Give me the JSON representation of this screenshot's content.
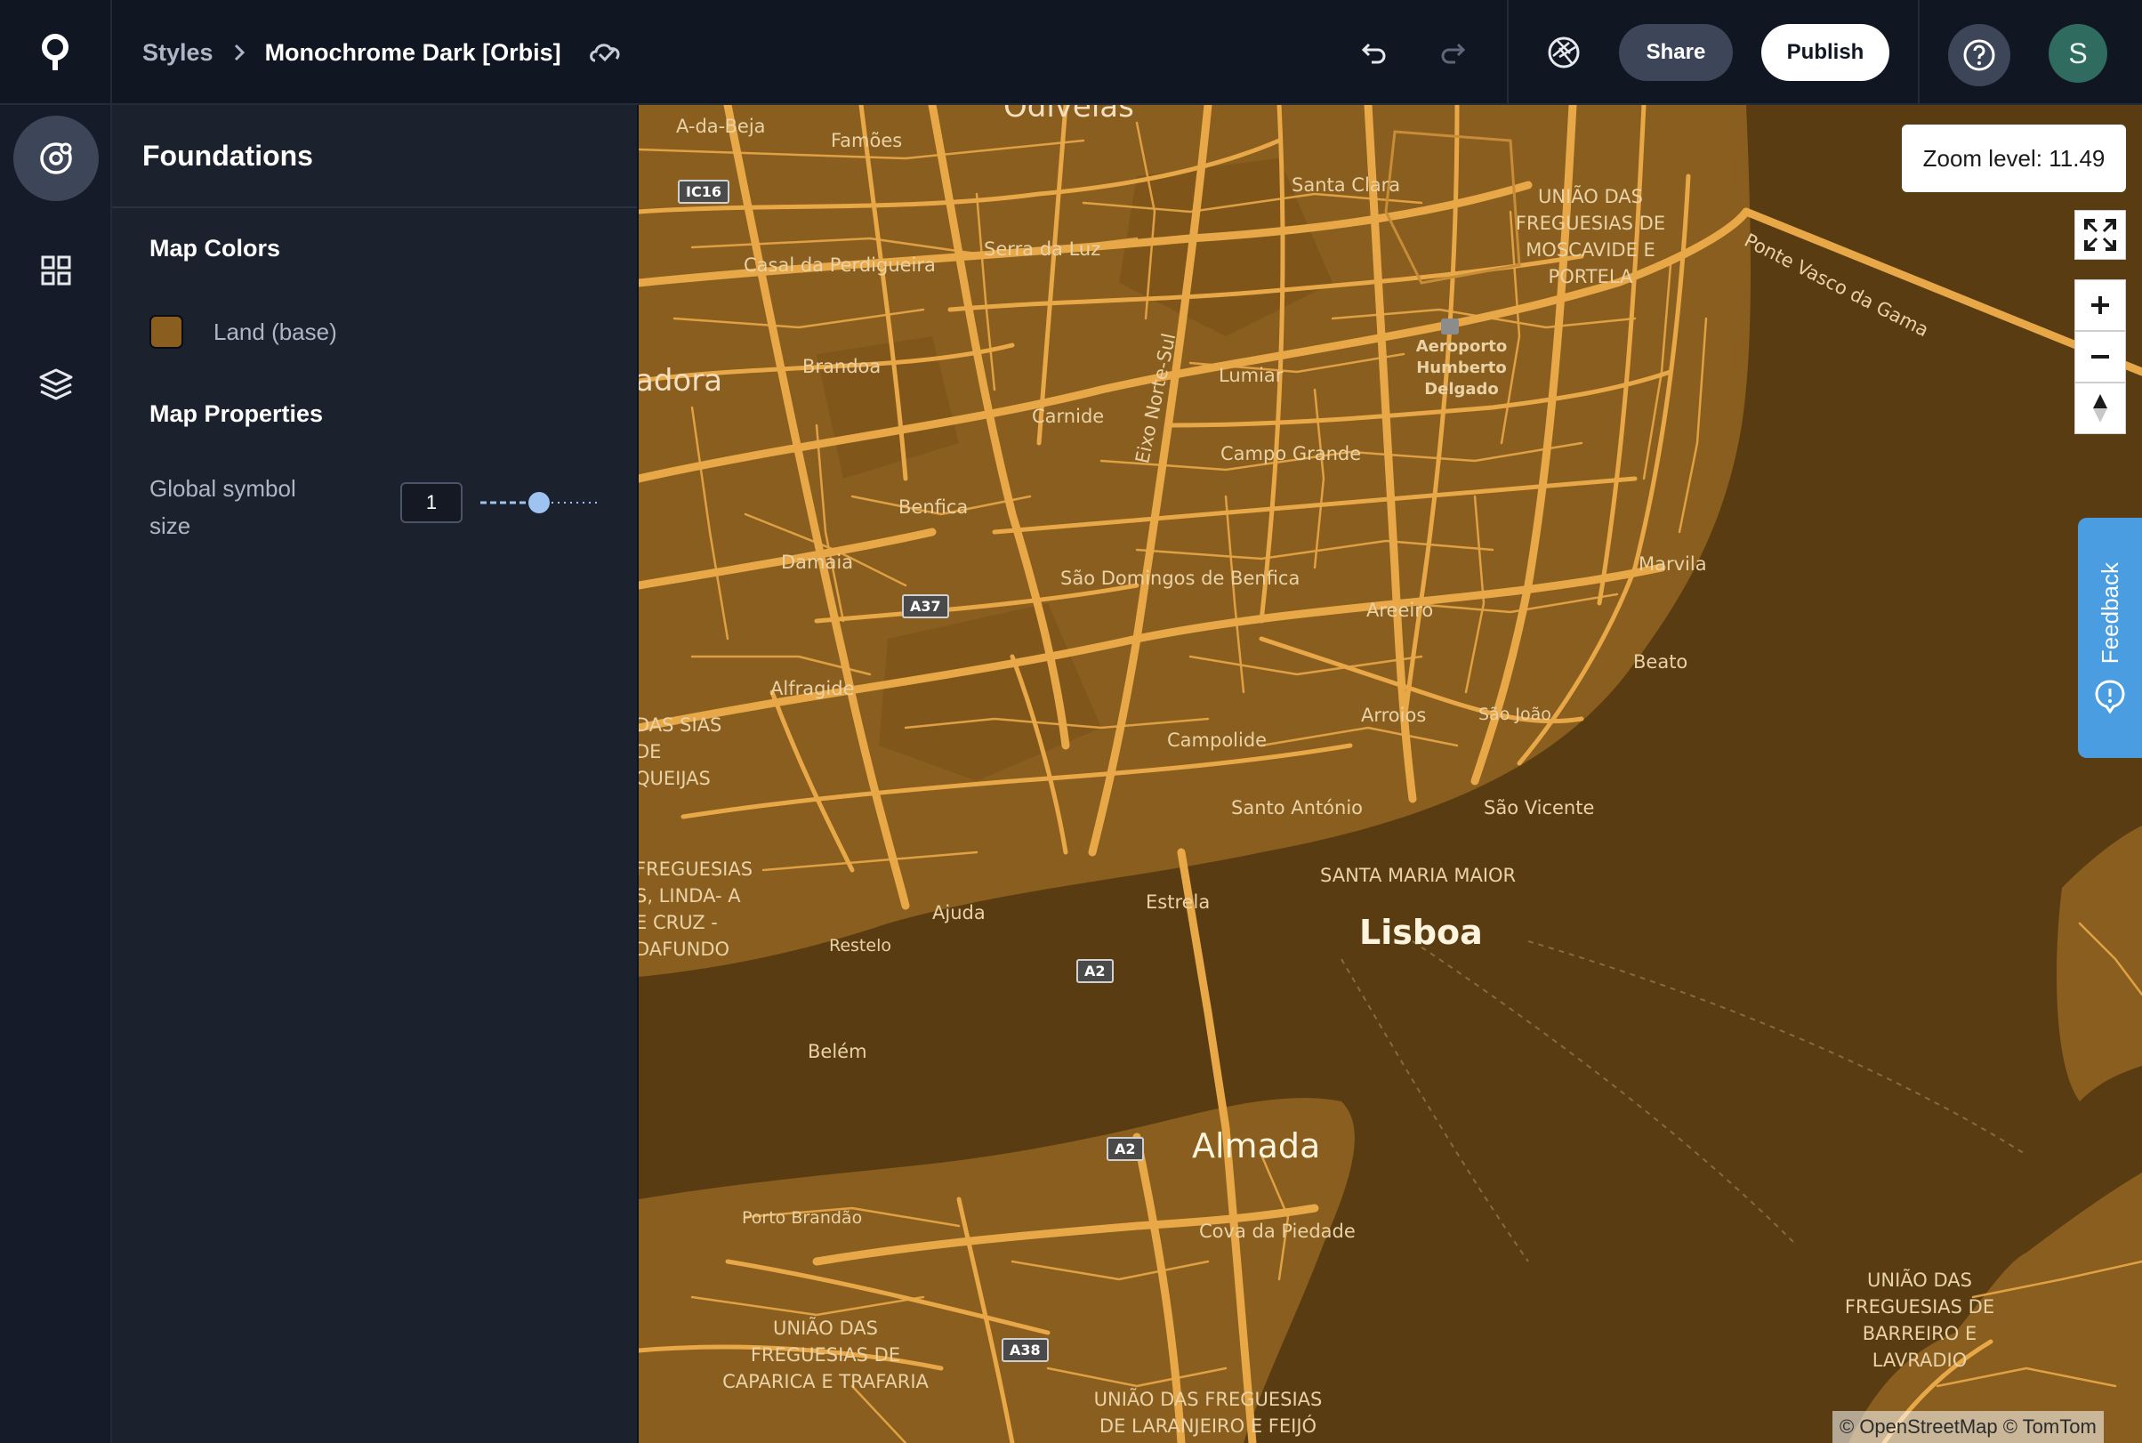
{
  "header": {
    "breadcrumb_root": "Styles",
    "style_name": "Monochrome Dark [Orbis]",
    "share_label": "Share",
    "publish_label": "Publish",
    "avatar_initial": "S"
  },
  "panel": {
    "title": "Foundations",
    "map_colors_title": "Map Colors",
    "land_label": "Land (base)",
    "land_color": "#8a5e1e",
    "map_properties_title": "Map Properties",
    "global_symbol_size_label": "Global symbol size",
    "global_symbol_size_value": "1"
  },
  "map": {
    "zoom_label": "Zoom level: 11.49",
    "feedback_label": "Feedback",
    "attribution": "© OpenStreetMap © TomTom",
    "water_color": "#5a3c12",
    "land_color": "#8a5e1e",
    "road_color": "#e8a848",
    "labels": {
      "odivelas": "Odivelas",
      "a_da_beja": "A-da-Beja",
      "famoes": "Famões",
      "santa_clara": "Santa Clara",
      "uniao_moscavide": "UNIÃO DAS FREGUESIAS DE MOSCAVIDE E PORTELA",
      "ponte": "Ponte Vasco da Gama",
      "casal": "Casal da Perdigueira",
      "serra": "Serra da Luz",
      "amadora": "adora",
      "brandoa": "Brandoa",
      "eixo": "Eixo Norte-Sul",
      "lumiar": "Lumiar",
      "aeroporto": "Aeroporto Humberto Delgado",
      "carnide": "Carnide",
      "campo_grande": "Campo Grande",
      "benfica": "Benfica",
      "damaia": "Damaia",
      "sao_domingos": "São Domingos de Benfica",
      "marvila": "Marvila",
      "areeiro": "Areeiro",
      "beato": "Beato",
      "alfragide": "Alfragide",
      "das_queijas": "DAS SIAS DE QUEIJAS",
      "arroios": "Arroios",
      "sao_joao": "São João",
      "campolide": "Campolide",
      "santo_antonio": "Santo António",
      "sao_vicente": "São Vicente",
      "freguesias_linda": "FREGUESIAS S, LINDA- A E CRUZ -DAFUNDO",
      "santa_maria": "SANTA MARIA MAIOR",
      "estrela": "Estrela",
      "ajuda": "Ajuda",
      "restelo": "Restelo",
      "lisboa": "Lisboa",
      "belem": "Belém",
      "almada": "Almada",
      "porto_brandao": "Porto Brandão",
      "cova": "Cova da Piedade",
      "uniao_barreiro": "UNIÃO DAS FREGUESIAS DE BARREIRO E LAVRADIO",
      "uniao_caparica": "UNIÃO DAS FREGUESIAS DE CAPARICA E TRAFARIA",
      "uniao_laranjeiro": "UNIÃO DAS FREGUESIAS DE LARANJEIRO E FEIJÓ"
    },
    "shields": {
      "ic16": "IC16",
      "a37": "A37",
      "a2_north": "A2",
      "a2_south": "A2",
      "a38": "A38"
    }
  }
}
